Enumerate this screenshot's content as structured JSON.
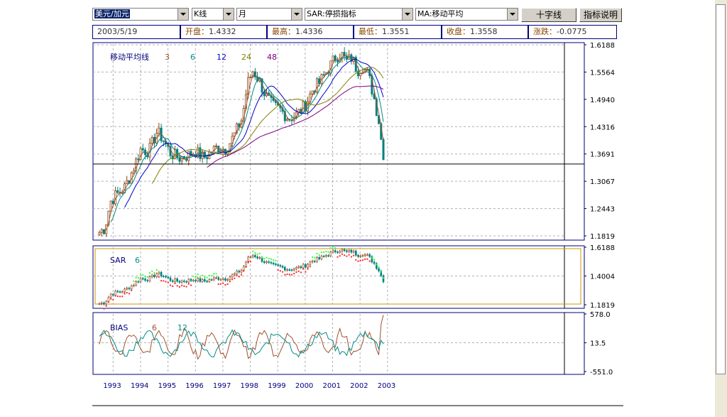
{
  "toolbar": {
    "pair_select": "美元/加元",
    "chart_type_select": "K线",
    "period_select": "月",
    "indicator1_select": "SAR:停损指标",
    "indicator2_select": "MA:移动平均",
    "crosshair_button": "十字线",
    "indicator_help_button": "指标说明"
  },
  "info_bar": {
    "date": "2003/5/19",
    "open_label": "开盘：",
    "open_value": "1.4332",
    "high_label": "最高：",
    "high_value": "1.4336",
    "low_label": "最低：",
    "low_value": "1.3551",
    "close_label": "收盘：",
    "close_value": "1.3558",
    "change_label": "涨跌：",
    "change_value": "-0.0775"
  },
  "colors": {
    "frame": "#00007f",
    "up_candle": "#8b4513",
    "down_candle": "#008080",
    "ma3": "#a0522d",
    "ma6": "#008b8b",
    "ma12": "#0000cd",
    "ma24": "#808000",
    "ma48": "#800080",
    "sar_green": "#33ff33",
    "sar_red": "#ff2222",
    "bias6": "#a0522d",
    "bias12": "#008b8b",
    "crosshair": "#000000",
    "grid": "#b0b0b0"
  },
  "chart_data": [
    {
      "type": "candlestick",
      "title": "移动平均线",
      "series_legend": [
        {
          "name": "3",
          "color": "#a0522d"
        },
        {
          "name": "6",
          "color": "#008b8b"
        },
        {
          "name": "12",
          "color": "#0000cd"
        },
        {
          "name": "24",
          "color": "#808000"
        },
        {
          "name": "48",
          "color": "#800080"
        }
      ],
      "x": [
        "1993",
        "1994",
        "1995",
        "1996",
        "1997",
        "1998",
        "1999",
        "2000",
        "2001",
        "2002",
        "2003"
      ],
      "ytick_labels": [
        "1.6188",
        "1.5564",
        "1.4940",
        "1.4316",
        "1.3691",
        "1.3067",
        "1.2443",
        "1.1819"
      ],
      "yticks": [
        1.6188,
        1.5564,
        1.494,
        1.4316,
        1.3691,
        1.3067,
        1.2443,
        1.1819
      ],
      "ylim": [
        1.1819,
        1.6188
      ],
      "crosshair_y": 1.3558,
      "close_path": [
        {
          "t": 1993.0,
          "v": 1.19
        },
        {
          "t": 1993.2,
          "v": 1.2
        },
        {
          "t": 1993.4,
          "v": 1.26
        },
        {
          "t": 1993.6,
          "v": 1.275
        },
        {
          "t": 1993.9,
          "v": 1.29
        },
        {
          "t": 1994.2,
          "v": 1.33
        },
        {
          "t": 1994.5,
          "v": 1.38
        },
        {
          "t": 1994.8,
          "v": 1.375
        },
        {
          "t": 1995.1,
          "v": 1.42
        },
        {
          "t": 1995.3,
          "v": 1.405
        },
        {
          "t": 1995.6,
          "v": 1.37
        },
        {
          "t": 1995.9,
          "v": 1.36
        },
        {
          "t": 1996.2,
          "v": 1.365
        },
        {
          "t": 1996.5,
          "v": 1.375
        },
        {
          "t": 1996.8,
          "v": 1.36
        },
        {
          "t": 1997.0,
          "v": 1.37
        },
        {
          "t": 1997.3,
          "v": 1.385
        },
        {
          "t": 1997.6,
          "v": 1.38
        },
        {
          "t": 1997.9,
          "v": 1.41
        },
        {
          "t": 1998.2,
          "v": 1.45
        },
        {
          "t": 1998.4,
          "v": 1.53
        },
        {
          "t": 1998.6,
          "v": 1.56
        },
        {
          "t": 1998.8,
          "v": 1.54
        },
        {
          "t": 1999.0,
          "v": 1.51
        },
        {
          "t": 1999.3,
          "v": 1.48
        },
        {
          "t": 1999.6,
          "v": 1.47
        },
        {
          "t": 1999.9,
          "v": 1.45
        },
        {
          "t": 2000.2,
          "v": 1.46
        },
        {
          "t": 2000.5,
          "v": 1.48
        },
        {
          "t": 2000.8,
          "v": 1.52
        },
        {
          "t": 2001.0,
          "v": 1.53
        },
        {
          "t": 2001.3,
          "v": 1.56
        },
        {
          "t": 2001.6,
          "v": 1.59
        },
        {
          "t": 2001.8,
          "v": 1.6
        },
        {
          "t": 2002.0,
          "v": 1.58
        },
        {
          "t": 2002.2,
          "v": 1.59
        },
        {
          "t": 2002.4,
          "v": 1.56
        },
        {
          "t": 2002.6,
          "v": 1.57
        },
        {
          "t": 2002.8,
          "v": 1.55
        },
        {
          "t": 2003.0,
          "v": 1.5
        },
        {
          "t": 2003.2,
          "v": 1.44
        },
        {
          "t": 2003.35,
          "v": 1.356
        }
      ]
    },
    {
      "type": "line",
      "title": "SAR",
      "series_legend": [
        {
          "name": "6",
          "color": "#008b8b"
        }
      ],
      "ytick_labels": [
        "1.6188",
        "1.4004",
        "1.1819"
      ],
      "yticks": [
        1.6188,
        1.4004,
        1.1819
      ],
      "ylim": [
        1.1819,
        1.6188
      ]
    },
    {
      "type": "line",
      "title": "BIAS",
      "series_legend": [
        {
          "name": "6",
          "color": "#a0522d"
        },
        {
          "name": "12",
          "color": "#008b8b"
        }
      ],
      "ytick_labels": [
        "578.0",
        "13.5",
        "-551.0"
      ],
      "yticks": [
        578.0,
        13.5,
        -551.0
      ],
      "ylim": [
        -551.0,
        578.0
      ]
    }
  ]
}
